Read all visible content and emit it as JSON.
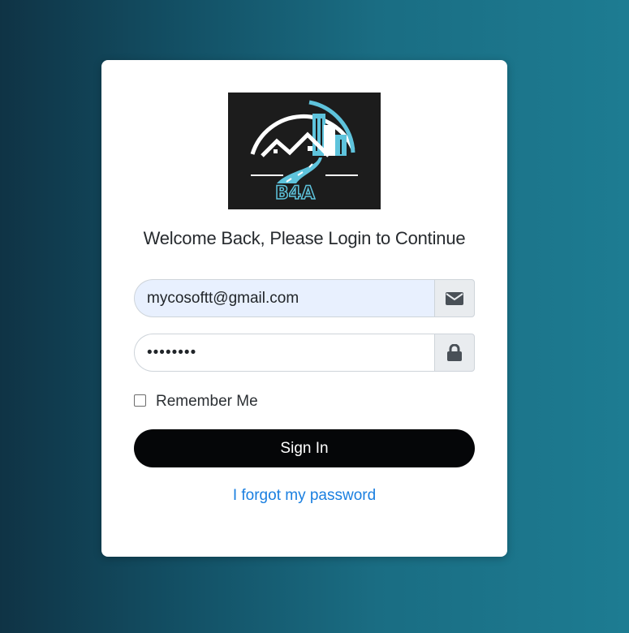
{
  "logo": {
    "text": "B4A"
  },
  "heading": "Welcome Back, Please Login to Continue",
  "email_field": {
    "value": "mycosoftt@gmail.com",
    "icon": "envelope-icon"
  },
  "password_field": {
    "masked_value": "••••••••",
    "icon": "lock-icon"
  },
  "remember": {
    "label": "Remember Me",
    "checked": false
  },
  "signin_button": {
    "label": "Sign In"
  },
  "forgot_link": {
    "label": "I forgot my password"
  },
  "colors": {
    "primary_button": "#050608",
    "link": "#1a7fe0",
    "autofill_bg": "#e8f0fe",
    "logo_accent": "#5ec3dc"
  }
}
